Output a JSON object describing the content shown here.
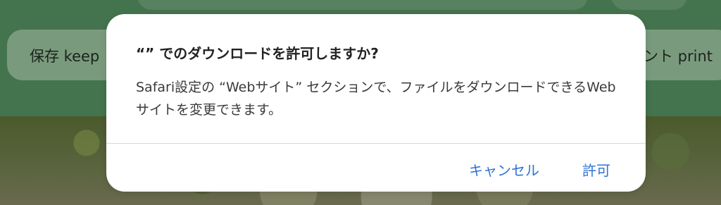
{
  "background": {
    "left_chip_label": "保存 keep",
    "right_chip_label": "ント print"
  },
  "dialog": {
    "title": "“” でのダウンロードを許可しますか?",
    "message": "Safari設定の “Webサイト” セクションで、ファイルをダウンロードできるWebサイトを変更できます。",
    "cancel_label": "キャンセル",
    "allow_label": "許可"
  },
  "colors": {
    "accent": "#2f72d6",
    "dialog_bg": "#ffffff"
  }
}
